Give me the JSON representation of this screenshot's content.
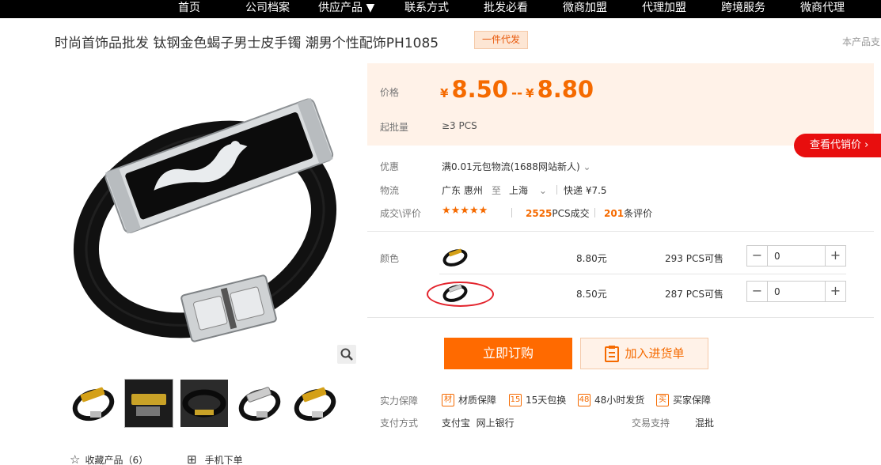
{
  "nav": [
    "首页",
    "公司档案",
    "供应产品 ▼",
    "联系方式",
    "批发必看",
    "微商加盟",
    "代理加盟",
    "跨境服务",
    "微商代理"
  ],
  "product": {
    "title": "时尚首饰品批发 钛钢金色蝎子男士皮手镯 潮男个性配饰PH1085",
    "badge": "一件代发",
    "right_note": "本产品支"
  },
  "gallery": {
    "thumbnails": [
      "thumb-1",
      "thumb-2",
      "thumb-3",
      "thumb-4",
      "thumb-5"
    ],
    "collect_label": "收藏产品（6）",
    "mobile_order_label": "手机下单"
  },
  "price": {
    "label": "价格",
    "currency": "¥",
    "min": "8.50",
    "separator": "--",
    "max": "8.80",
    "moq_label": "起批量",
    "moq_value": "≥3  PCS",
    "agent_button": "查看代销价"
  },
  "details": {
    "promo_label": "优惠",
    "promo_value": "满0.01元包物流(1688网站新人)",
    "logistics_label": "物流",
    "from_city": "广东 惠州",
    "to_word": "至",
    "to_city": "上海",
    "express": "快递 ¥7.5",
    "deal_label": "成交\\评价",
    "stars": "★★★★★",
    "deals_num": "2525",
    "deals_unit": "PCS成交",
    "reviews_num": "201",
    "reviews_unit": "条评价"
  },
  "sku": {
    "label": "颜色",
    "rows": [
      {
        "price": "8.80元",
        "stock": "293 PCS可售",
        "qty": "0"
      },
      {
        "price": "8.50元",
        "stock": "287 PCS可售",
        "qty": "0"
      }
    ]
  },
  "actions": {
    "buy": "立即订购",
    "cart": "加入进货单"
  },
  "guarantee": {
    "label": "实力保障",
    "items": [
      {
        "icon": "材",
        "text": "材质保障"
      },
      {
        "icon": "15",
        "text": "15天包换"
      },
      {
        "icon": "48",
        "text": "48小时发货"
      },
      {
        "icon": "买",
        "text": "买家保障"
      }
    ]
  },
  "payment": {
    "label": "支付方式",
    "methods": "支付宝  网上银行",
    "trade_label": "交易支持",
    "trade_value": "混批"
  },
  "colors": {
    "accent": "#f56a00",
    "buy_bg": "#ff6a00",
    "agent_red": "#e80e0e",
    "price_bg": "#fff2e8"
  }
}
